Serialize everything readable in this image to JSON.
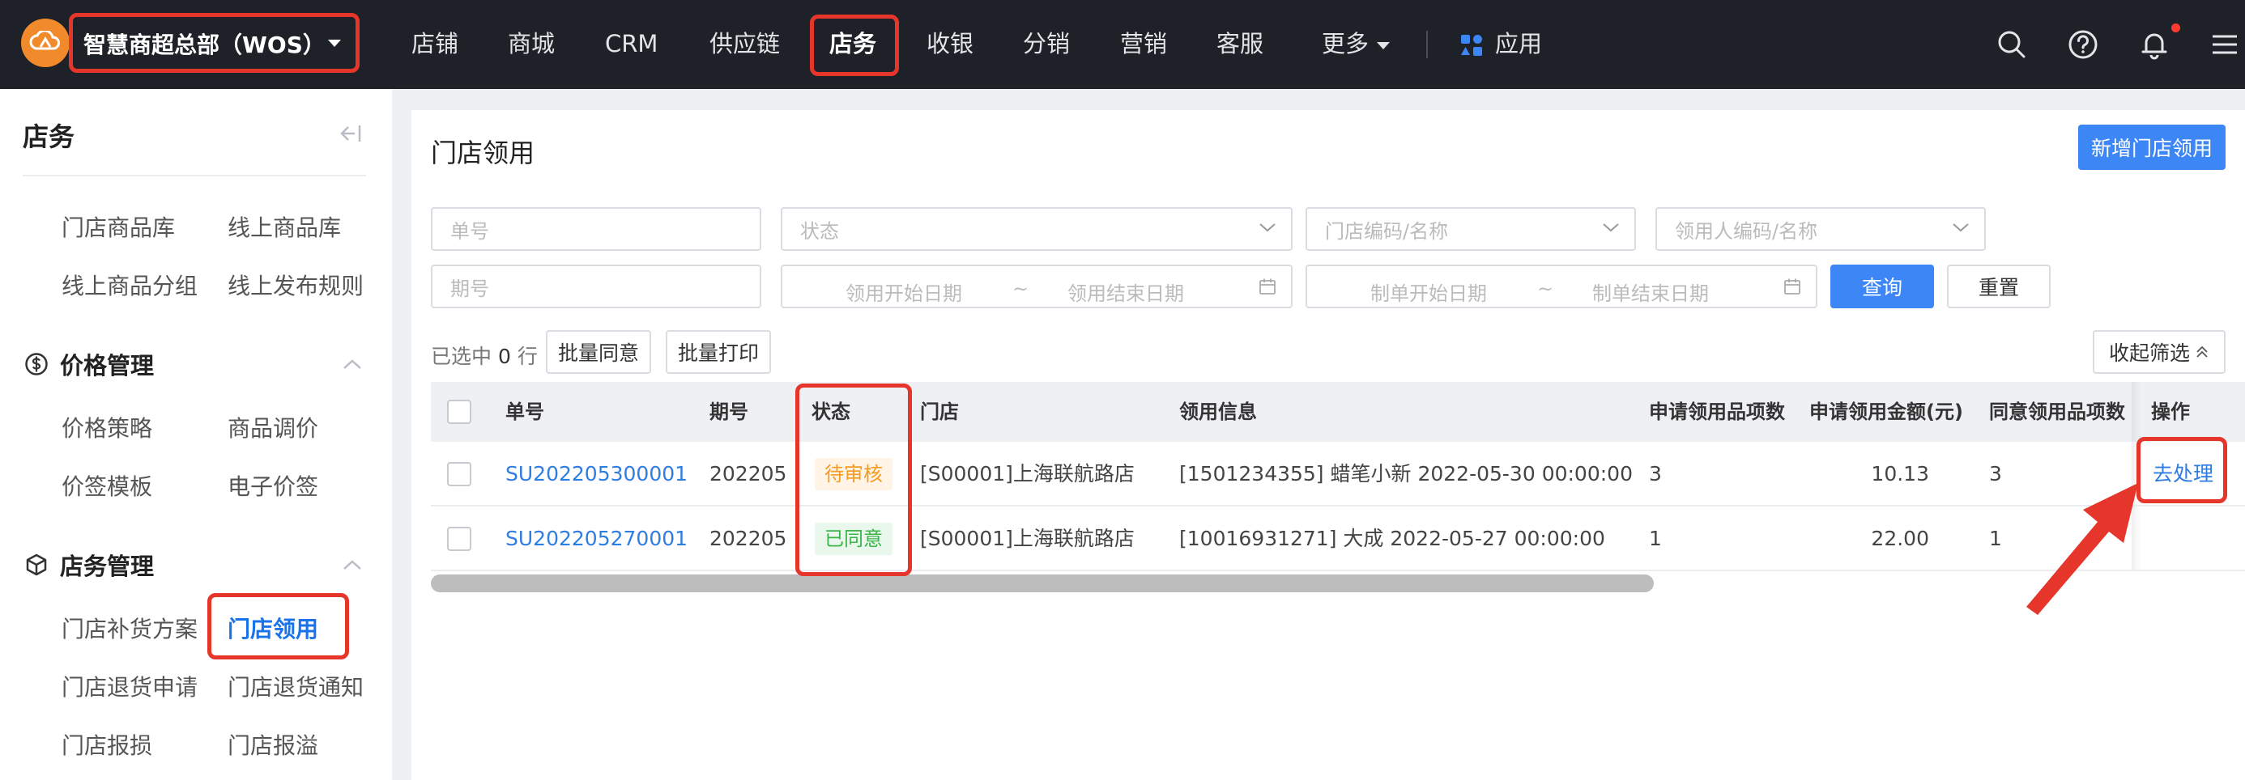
{
  "header": {
    "shop_name": "智慧商超总部（WOS）",
    "nav": [
      "店铺",
      "商城",
      "CRM",
      "供应链",
      "店务",
      "收银",
      "分销",
      "营销",
      "客服"
    ],
    "more_label": "更多",
    "apps_label": "应用",
    "active_nav": "店务"
  },
  "sidebar": {
    "title": "店务",
    "top_links": [
      "门店商品库",
      "线上商品库",
      "线上商品分组",
      "线上发布规则"
    ],
    "groups": [
      {
        "label": "价格管理",
        "icon": "dollar-circle-icon",
        "items": [
          "价格策略",
          "商品调价",
          "价签模板",
          "电子价签"
        ]
      },
      {
        "label": "店务管理",
        "icon": "cube-icon",
        "items": [
          "门店补货方案",
          "门店领用",
          "门店退货申请",
          "门店退货通知",
          "门店报损",
          "门店报溢"
        ]
      }
    ],
    "active_item": "门店领用"
  },
  "page": {
    "title": "门店领用",
    "new_button": "新增门店领用",
    "filters": {
      "order_no": "单号",
      "status": "状态",
      "store": "门店编码/名称",
      "requester": "领用人编码/名称",
      "period": "期号",
      "use_start": "领用开始日期",
      "use_end": "领用结束日期",
      "make_start": "制单开始日期",
      "make_end": "制单结束日期",
      "range_sep": "~"
    },
    "query_button": "查询",
    "reset_button": "重置",
    "selected_prefix": "已选中",
    "selected_count": "0",
    "selected_suffix": "行",
    "bulk_approve": "批量同意",
    "bulk_print": "批量打印",
    "collapse_filter": "收起筛选"
  },
  "table": {
    "columns": [
      "单号",
      "期号",
      "状态",
      "门店",
      "领用信息",
      "申请领用品项数",
      "申请领用金额(元)",
      "同意领用品项数",
      "操作"
    ],
    "rows": [
      {
        "order_no": "SU202205300001",
        "period": "202205",
        "status": "待审核",
        "status_type": "pending",
        "store": "[S00001]上海联航路店",
        "info": "[1501234355] 蜡笔小新 2022-05-30 00:00:00",
        "apply_items": "3",
        "apply_amount": "10.13",
        "agree_items": "3",
        "action": "去处理"
      },
      {
        "order_no": "SU202205270001",
        "period": "202205",
        "status": "已同意",
        "status_type": "approved",
        "store": "[S00001]上海联航路店",
        "info": "[10016931271] 大成 2022-05-27 00:00:00",
        "apply_items": "1",
        "apply_amount": "22.00",
        "agree_items": "1",
        "action": ""
      }
    ]
  },
  "colors": {
    "topbar": "#1f2129",
    "primary": "#3d86f6",
    "link": "#2f7de1",
    "annotation": "#e6352b",
    "pending": "#f59a23",
    "approved": "#3bb54a"
  }
}
